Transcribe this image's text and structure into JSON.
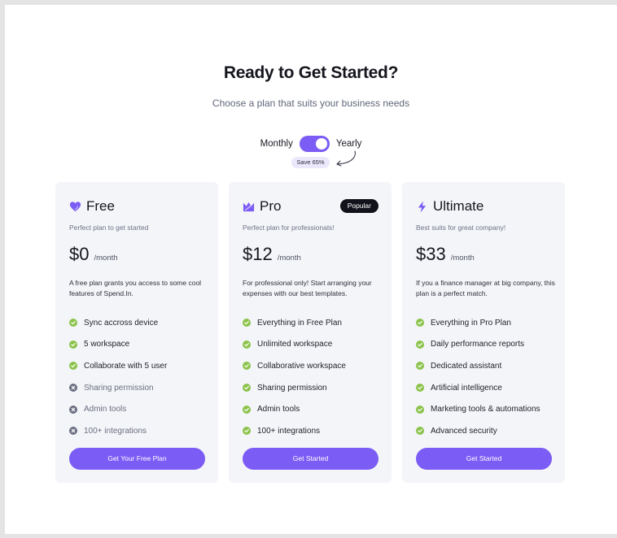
{
  "header": {
    "title": "Ready to Get Started?",
    "subtitle": "Choose a plan that suits your business needs"
  },
  "billing": {
    "monthly_label": "Monthly",
    "yearly_label": "Yearly",
    "selected": "Yearly",
    "save_badge": "Save 65%"
  },
  "colors": {
    "accent": "#7b5cf5",
    "check": "#8bc34a",
    "cross": "#6a6e80",
    "card_bg": "#f4f5f8"
  },
  "plans": [
    {
      "name": "Free",
      "icon": "heart-icon",
      "tagline": "Perfect plan to get started",
      "price": "$0",
      "period": "/month",
      "description": "A free plan grants you access to some cool features of Spend.In.",
      "features": [
        {
          "label": "Sync accross device",
          "included": true
        },
        {
          "label": "5 workspace",
          "included": true
        },
        {
          "label": "Collaborate with 5 user",
          "included": true
        },
        {
          "label": "Sharing permission",
          "included": false
        },
        {
          "label": "Admin tools",
          "included": false
        },
        {
          "label": "100+ integrations",
          "included": false
        }
      ],
      "cta": "Get Your Free Plan"
    },
    {
      "name": "Pro",
      "icon": "crown-icon",
      "badge": "Popular",
      "tagline": "Perfect plan for professionals!",
      "price": "$12",
      "period": "/month",
      "description": "For professional only! Start arranging your expenses with our best templates.",
      "features": [
        {
          "label": "Everything in Free Plan",
          "included": true
        },
        {
          "label": "Unlimited workspace",
          "included": true
        },
        {
          "label": "Collaborative workspace",
          "included": true
        },
        {
          "label": "Sharing permission",
          "included": true
        },
        {
          "label": "Admin tools",
          "included": true
        },
        {
          "label": "100+ integrations",
          "included": true
        }
      ],
      "cta": "Get Started"
    },
    {
      "name": "Ultimate",
      "icon": "lightning-icon",
      "tagline": "Best suits for great company!",
      "price": "$33",
      "period": "/month",
      "description": "If you a finance manager at big company, this plan is a perfect match.",
      "features": [
        {
          "label": "Everything in Pro Plan",
          "included": true
        },
        {
          "label": "Daily performance reports",
          "included": true
        },
        {
          "label": "Dedicated assistant",
          "included": true
        },
        {
          "label": "Artificial intelligence",
          "included": true
        },
        {
          "label": "Marketing tools & automations",
          "included": true
        },
        {
          "label": "Advanced security",
          "included": true
        }
      ],
      "cta": "Get Started"
    }
  ]
}
